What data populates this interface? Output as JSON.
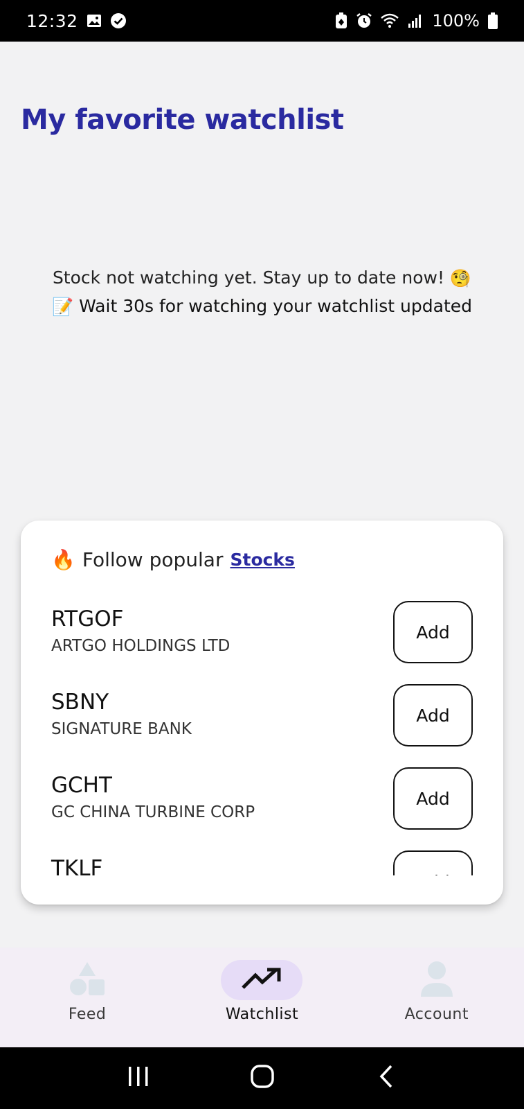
{
  "status_bar": {
    "time": "12:32",
    "battery_text": "100%",
    "left_icons": [
      "gallery-icon",
      "check-circle-icon"
    ],
    "right_icons": [
      "battery-saver-icon",
      "alarm-icon",
      "wifi-icon",
      "signal-icon",
      "battery-icon"
    ]
  },
  "page": {
    "title": "My favorite watchlist"
  },
  "empty_state": {
    "line1": "Stock not watching yet. Stay up to date now!",
    "line2": "Wait 30s for watching your watchlist updated",
    "emoji1": "🧐",
    "emoji2": "📝"
  },
  "popular": {
    "emoji": "🔥",
    "header_text": "Follow popular",
    "header_link": "Stocks",
    "button_label": "Add",
    "stocks": [
      {
        "symbol": "RTGOF",
        "name": "ARTGO HOLDINGS LTD"
      },
      {
        "symbol": "SBNY",
        "name": "SIGNATURE BANK"
      },
      {
        "symbol": "GCHT",
        "name": "GC CHINA TURBINE CORP"
      },
      {
        "symbol": "TKLF",
        "name": ""
      }
    ]
  },
  "bottom_nav": {
    "items": [
      {
        "label": "Feed",
        "icon": "feed-shapes-icon",
        "active": false
      },
      {
        "label": "Watchlist",
        "icon": "trending-up-icon",
        "active": true
      },
      {
        "label": "Account",
        "icon": "account-icon",
        "active": false
      }
    ]
  },
  "colors": {
    "accent": "#2a2aa0",
    "background": "#f2f2f3",
    "nav_background": "#f3eef6",
    "nav_active_pill": "#e6dcf7"
  }
}
